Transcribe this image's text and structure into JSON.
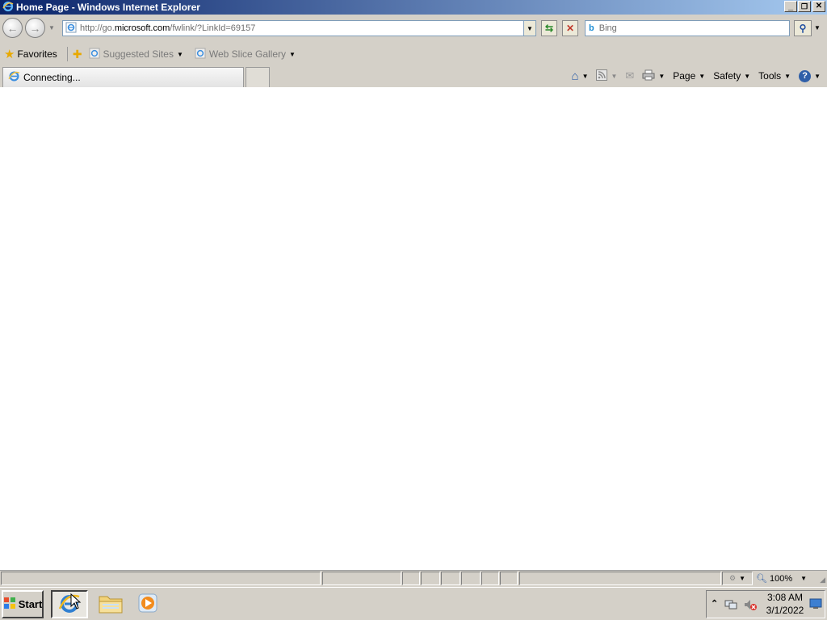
{
  "window": {
    "title": "Home Page - Windows Internet Explorer",
    "controls": {
      "minimize": "_",
      "restore": "❐",
      "close": "✕"
    }
  },
  "address": {
    "url_prefix": "http://go.",
    "url_domain": "microsoft.com",
    "url_suffix": "/fwlink/?LinkId=69157",
    "search_placeholder": "Bing"
  },
  "favorites": {
    "favorites_label": "Favorites",
    "suggested_sites_label": "Suggested Sites",
    "web_slice_gallery_label": "Web Slice Gallery"
  },
  "tab": {
    "label": "Connecting..."
  },
  "commandbar": {
    "page_label": "Page",
    "safety_label": "Safety",
    "tools_label": "Tools"
  },
  "statusbar": {
    "zoom": "100%"
  },
  "taskbar": {
    "start_label": "Start",
    "time": "3:08 AM",
    "date": "3/1/2022"
  },
  "colors": {
    "title_gradient_start": "#0a246a",
    "title_gradient_end": "#a6caf0",
    "chrome": "#d4d0c8"
  }
}
